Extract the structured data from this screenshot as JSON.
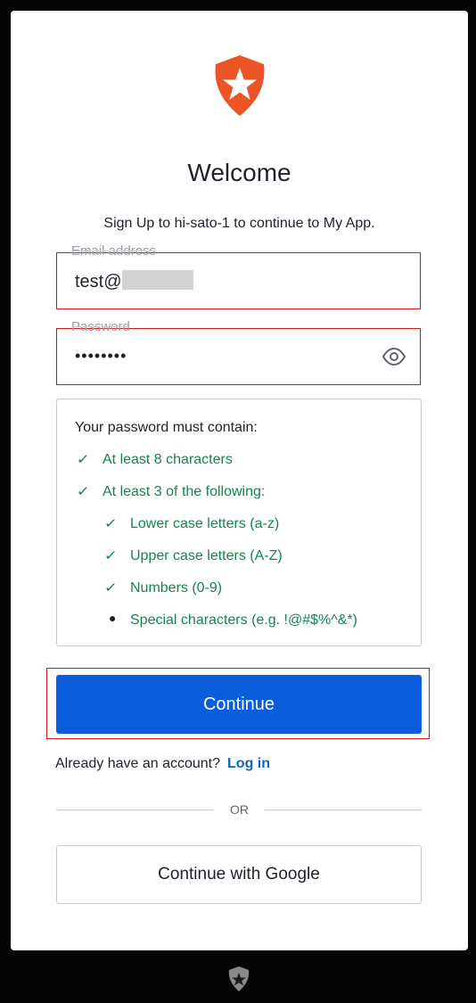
{
  "header": {
    "logo_icon": "auth0-shield-star-icon",
    "title": "Welcome",
    "subtitle": "Sign Up to hi-sato-1 to continue to My App."
  },
  "email_field": {
    "label": "Email address",
    "value": "test@"
  },
  "password_field": {
    "label": "Password",
    "value": "••••••••",
    "toggle_icon": "eye-icon"
  },
  "policy": {
    "title": "Your password must contain:",
    "rules": [
      {
        "label": "At least 8 characters",
        "status": "met"
      },
      {
        "label": "At least 3 of the following:",
        "status": "met"
      },
      {
        "label": "Lower case letters (a-z)",
        "status": "met"
      },
      {
        "label": "Upper case letters (A-Z)",
        "status": "met"
      },
      {
        "label": "Numbers (0-9)",
        "status": "met"
      },
      {
        "label": "Special characters (e.g. !@#$%^&*)",
        "status": "unmet"
      }
    ]
  },
  "actions": {
    "continue_label": "Continue",
    "already_text": "Already have an account?",
    "login_label": "Log in",
    "or_label": "OR",
    "google_label": "Continue with Google"
  },
  "footer": {
    "logo_icon": "auth0-badge-icon"
  },
  "colors": {
    "primary": "#0a5ddb",
    "success": "#13864e",
    "link": "#0a69b6",
    "highlight": "#d21a1a"
  }
}
